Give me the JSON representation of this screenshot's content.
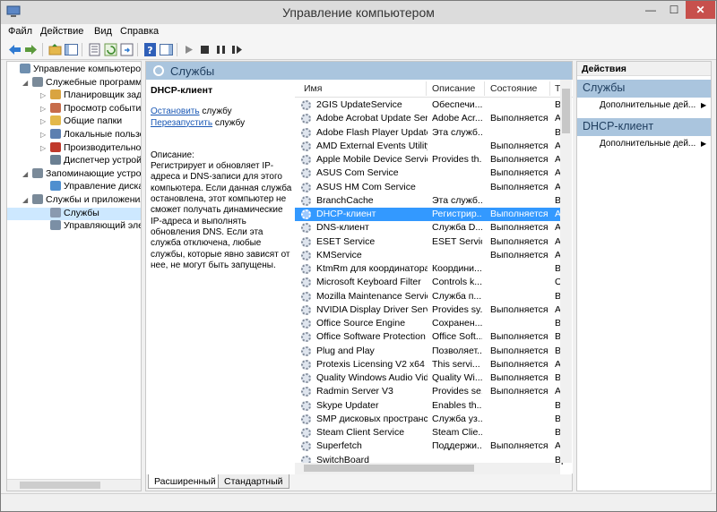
{
  "window": {
    "title": "Управление компьютером",
    "min": "—",
    "max": "☐",
    "close": "✕"
  },
  "menu": [
    "Файл",
    "Действие",
    "Вид",
    "Справка"
  ],
  "tree": [
    {
      "label": "Управление компьютером (л",
      "level": 0,
      "color": "#6f8faf"
    },
    {
      "label": "Служебные программы",
      "level": 1,
      "color": "#7a8a99",
      "arrow": "◢"
    },
    {
      "label": "Планировщик заданий",
      "level": 2,
      "color": "#d9a441",
      "arrow": "▷"
    },
    {
      "label": "Просмотр событий",
      "level": 2,
      "color": "#c76c4a",
      "arrow": "▷"
    },
    {
      "label": "Общие папки",
      "level": 2,
      "color": "#e3b84a",
      "arrow": "▷"
    },
    {
      "label": "Локальные пользовате",
      "level": 2,
      "color": "#5d7fb0",
      "arrow": "▷"
    },
    {
      "label": "Производительность",
      "level": 2,
      "color": "#c0392b",
      "arrow": "▷"
    },
    {
      "label": "Диспетчер устройств",
      "level": 2,
      "color": "#6a7f92"
    },
    {
      "label": "Запоминающие устройст",
      "level": 1,
      "color": "#7a8a99",
      "arrow": "◢"
    },
    {
      "label": "Управление дисками",
      "level": 2,
      "color": "#4f8fcf"
    },
    {
      "label": "Службы и приложения",
      "level": 1,
      "color": "#7a8a99",
      "arrow": "◢"
    },
    {
      "label": "Службы",
      "level": 2,
      "color": "#8a9aaf",
      "selected": true
    },
    {
      "label": "Управляющий элемен",
      "level": 2,
      "color": "#7b8fa5"
    }
  ],
  "center": {
    "title": "Службы",
    "desc_title": "DHCP-клиент",
    "stop_link": "Остановить",
    "stop_suffix": " службу",
    "restart_link": "Перезапустить",
    "restart_suffix": " службу",
    "desc_label": "Описание:",
    "desc_text": "Регистрирует и обновляет IP-адреса и DNS-записи для этого компьютера. Если данная служба остановлена, этот компьютер не сможет получать динамические IP-адреса и выполнять обновления DNS. Если эта служба отключена, любые службы, которые явно зависят от нее, не могут быть запущены."
  },
  "columns": {
    "name": "Имя",
    "desc": "Описание",
    "status": "Состояние",
    "type": "Т"
  },
  "services": [
    {
      "name": "2GIS UpdateService",
      "desc": "Обеспечи...",
      "status": "",
      "type": "Вр"
    },
    {
      "name": "Adobe Acrobat Update Serv...",
      "desc": "Adobe Acr...",
      "status": "Выполняется",
      "type": "Ав"
    },
    {
      "name": "Adobe Flash Player Update ...",
      "desc": "Эта служб...",
      "status": "",
      "type": "Вр"
    },
    {
      "name": "AMD External Events Utility",
      "desc": "",
      "status": "Выполняется",
      "type": "Ав"
    },
    {
      "name": "Apple Mobile Device Service",
      "desc": "Provides th...",
      "status": "Выполняется",
      "type": "Ав"
    },
    {
      "name": "ASUS Com Service",
      "desc": "",
      "status": "Выполняется",
      "type": "Ав"
    },
    {
      "name": "ASUS HM Com Service",
      "desc": "",
      "status": "Выполняется",
      "type": "Ав"
    },
    {
      "name": "BranchCache",
      "desc": "Эта служб...",
      "status": "",
      "type": "Вр"
    },
    {
      "name": "DHCP-клиент",
      "desc": "Регистрир...",
      "status": "Выполняется",
      "type": "Ав",
      "selected": true
    },
    {
      "name": "DNS-клиент",
      "desc": "Служба D...",
      "status": "Выполняется",
      "type": "Ав"
    },
    {
      "name": "ESET Service",
      "desc": "ESET Service",
      "status": "Выполняется",
      "type": "Ав"
    },
    {
      "name": "KMService",
      "desc": "",
      "status": "Выполняется",
      "type": "Ав"
    },
    {
      "name": "KtmRm для координатора ...",
      "desc": "Координи...",
      "status": "",
      "type": "Вр"
    },
    {
      "name": "Microsoft Keyboard Filter",
      "desc": "Controls k...",
      "status": "",
      "type": "От"
    },
    {
      "name": "Mozilla Maintenance Service",
      "desc": "Служба п...",
      "status": "",
      "type": "Вр"
    },
    {
      "name": "NVIDIA Display Driver Service",
      "desc": "Provides sy...",
      "status": "Выполняется",
      "type": "Ав"
    },
    {
      "name": "Office  Source Engine",
      "desc": "Сохранен...",
      "status": "",
      "type": "Вр"
    },
    {
      "name": "Office Software Protection ...",
      "desc": "Office Soft...",
      "status": "Выполняется",
      "type": "Вр"
    },
    {
      "name": "Plug and Play",
      "desc": "Позволяет...",
      "status": "Выполняется",
      "type": "Вр"
    },
    {
      "name": "Protexis Licensing V2 x64",
      "desc": "This servi...",
      "status": "Выполняется",
      "type": "Ав"
    },
    {
      "name": "Quality Windows Audio Vid...",
      "desc": "Quality Wi...",
      "status": "Выполняется",
      "type": "Вр"
    },
    {
      "name": "Radmin Server V3",
      "desc": "Provides se...",
      "status": "Выполняется",
      "type": "Ав"
    },
    {
      "name": "Skype Updater",
      "desc": "Enables th...",
      "status": "",
      "type": "Вр"
    },
    {
      "name": "SMP дисковых пространст...",
      "desc": "Служба уз...",
      "status": "",
      "type": "Вр"
    },
    {
      "name": "Steam Client Service",
      "desc": "Steam Clie...",
      "status": "",
      "type": "Вр"
    },
    {
      "name": "Superfetch",
      "desc": "Поддержи...",
      "status": "Выполняется",
      "type": "Ав"
    },
    {
      "name": "SwitchBoard",
      "desc": "",
      "status": "",
      "type": "Вр"
    }
  ],
  "tabs": {
    "extended": "Расширенный",
    "standard": "Стандартный"
  },
  "actions": {
    "header": "Действия",
    "section1": "Службы",
    "section1_item": "Дополнительные дей...",
    "section2": "DHCP-клиент",
    "section2_item": "Дополнительные дей..."
  }
}
